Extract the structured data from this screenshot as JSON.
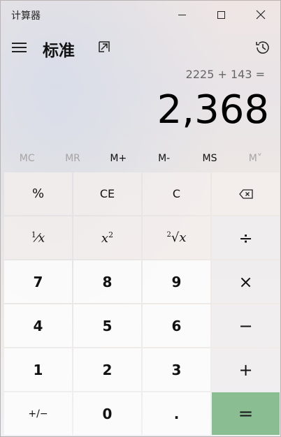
{
  "window": {
    "title": "计算器"
  },
  "header": {
    "mode": "标准"
  },
  "display": {
    "expression": "2225 + 143 =",
    "result": "2,368"
  },
  "memory": [
    {
      "label": "MC",
      "enabled": false
    },
    {
      "label": "MR",
      "enabled": false
    },
    {
      "label": "M+",
      "enabled": true
    },
    {
      "label": "M-",
      "enabled": true
    },
    {
      "label": "MS",
      "enabled": true
    },
    {
      "label": "M˅",
      "enabled": false
    }
  ],
  "keys": {
    "percent": "%",
    "ce": "CE",
    "c": "C",
    "reciprocal_num": "1",
    "reciprocal_den": "x",
    "square_base": "x",
    "square_exp": "2",
    "sqrt_index": "2",
    "sqrt_x": "x",
    "divide": "÷",
    "multiply": "×",
    "subtract": "−",
    "add": "+",
    "equals": "=",
    "negate": "+/−",
    "decimal": ".",
    "n7": "7",
    "n8": "8",
    "n9": "9",
    "n4": "4",
    "n5": "5",
    "n6": "6",
    "n1": "1",
    "n2": "2",
    "n3": "3",
    "n0": "0"
  },
  "colors": {
    "equals_bg": "#8bbd93"
  }
}
